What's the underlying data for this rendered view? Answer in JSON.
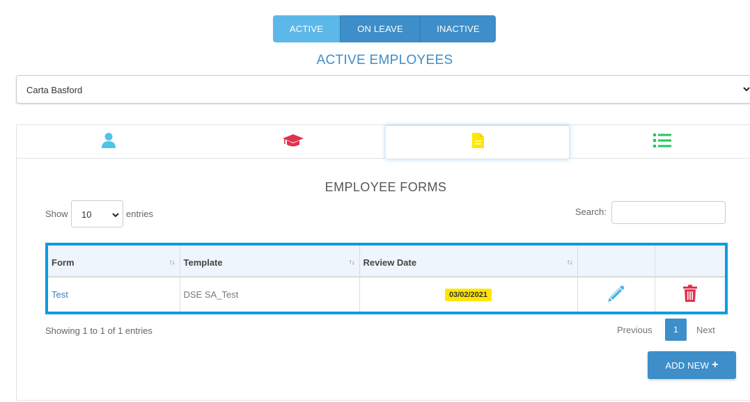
{
  "status_tabs": {
    "active": "ACTIVE",
    "on_leave": "ON LEAVE",
    "inactive": "INACTIVE"
  },
  "page_title": "ACTIVE EMPLOYEES",
  "employee_select": {
    "value": "Carta Basford"
  },
  "tabs": [
    {
      "icon": "user-icon",
      "color": "#4fc3ea"
    },
    {
      "icon": "graduation-cap-icon",
      "color": "#e0334d"
    },
    {
      "icon": "document-icon",
      "color": "#ffe600",
      "selected": true
    },
    {
      "icon": "list-icon",
      "color": "#22c55e"
    }
  ],
  "forms_title": "EMPLOYEE FORMS",
  "length": {
    "show": "Show",
    "value": "10",
    "entries": "entries"
  },
  "search": {
    "label": "Search:",
    "placeholder": ""
  },
  "table": {
    "columns": [
      "Form",
      "Template",
      "Review Date",
      "",
      ""
    ],
    "rows": [
      {
        "form": "Test",
        "template": "DSE SA_Test",
        "review_date": "03/02/2021"
      }
    ]
  },
  "info": "Showing 1 to 1 of 1 entries",
  "pager": {
    "previous": "Previous",
    "page": "1",
    "next": "Next"
  },
  "add_button": "ADD NEW",
  "colors": {
    "primary": "#3d8ec9",
    "active_tab": "#5db8ea",
    "table_border": "#0a9de0",
    "badge": "#ffe600",
    "delete": "#e0334d",
    "edit": "#4fb3e8"
  }
}
